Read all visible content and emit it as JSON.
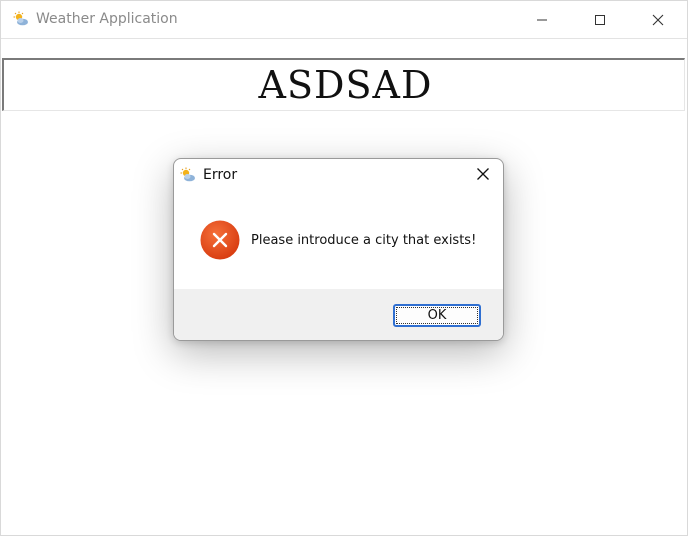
{
  "window": {
    "title": "Weather Application",
    "app_icon": "weather-sun-cloud-icon"
  },
  "titlebar_controls": {
    "minimize_icon": "minimize-icon",
    "maximize_icon": "maximize-icon",
    "close_icon": "close-icon"
  },
  "city_entry": {
    "value": "ASDSAD"
  },
  "dialog": {
    "title": "Error",
    "title_icon": "weather-sun-cloud-icon",
    "close_icon": "close-icon",
    "status_icon": "error-icon",
    "message": "Please introduce a city that exists!",
    "ok_label": "OK",
    "colors": {
      "error_red": "#e0461a",
      "focus_blue": "#2f6fd1",
      "footer_gray": "#f0f0f0"
    }
  }
}
